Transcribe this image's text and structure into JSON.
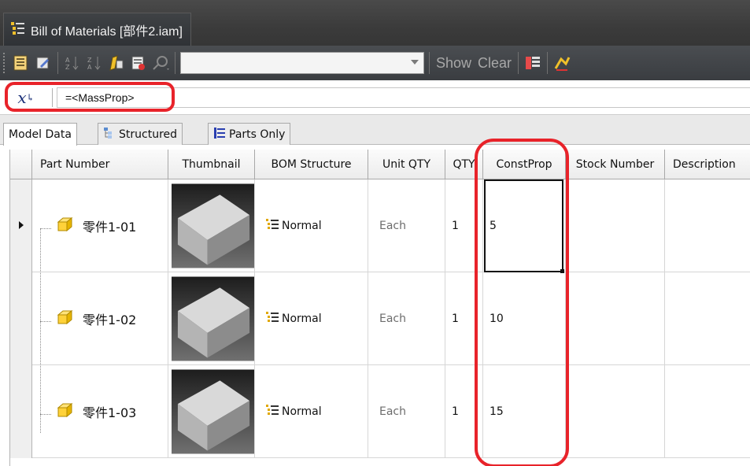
{
  "window": {
    "title": "Bill of Materials [部件2.iam]"
  },
  "toolbar": {
    "icons": [
      "view-options-icon",
      "edit-icon",
      "sort-ascending-icon",
      "sort-descending-icon",
      "renumber-icon",
      "export-icon",
      "find-icon"
    ],
    "combo_value": "",
    "show_label": "Show",
    "clear_label": "Clear",
    "right_icons": [
      "column-chooser-icon",
      "update-mass-icon"
    ]
  },
  "formula": {
    "icon": "expression-icon",
    "value": "=<MassProp>"
  },
  "tabs": [
    {
      "label": "Model Data",
      "icon": ""
    },
    {
      "label": "Structured",
      "icon": "structured-icon"
    },
    {
      "label": "Parts Only",
      "icon": "parts-only-icon"
    }
  ],
  "grid": {
    "columns": [
      "Part Number",
      "Thumbnail",
      "BOM Structure",
      "Unit QTY",
      "QTY",
      "ConstProp",
      "Stock Number",
      "Description"
    ],
    "rows": [
      {
        "selected": true,
        "part_number": "零件1-01",
        "bom_structure": "Normal",
        "unit_qty": "Each",
        "qty": "1",
        "constprop": "5",
        "stock_number": "",
        "description": ""
      },
      {
        "selected": false,
        "part_number": "零件1-02",
        "bom_structure": "Normal",
        "unit_qty": "Each",
        "qty": "1",
        "constprop": "10",
        "stock_number": "",
        "description": ""
      },
      {
        "selected": false,
        "part_number": "零件1-03",
        "bom_structure": "Normal",
        "unit_qty": "Each",
        "qty": "1",
        "constprop": "15",
        "stock_number": "",
        "description": ""
      }
    ]
  },
  "colors": {
    "highlight_red": "#e8232a",
    "part_icon": "#d9a400"
  }
}
